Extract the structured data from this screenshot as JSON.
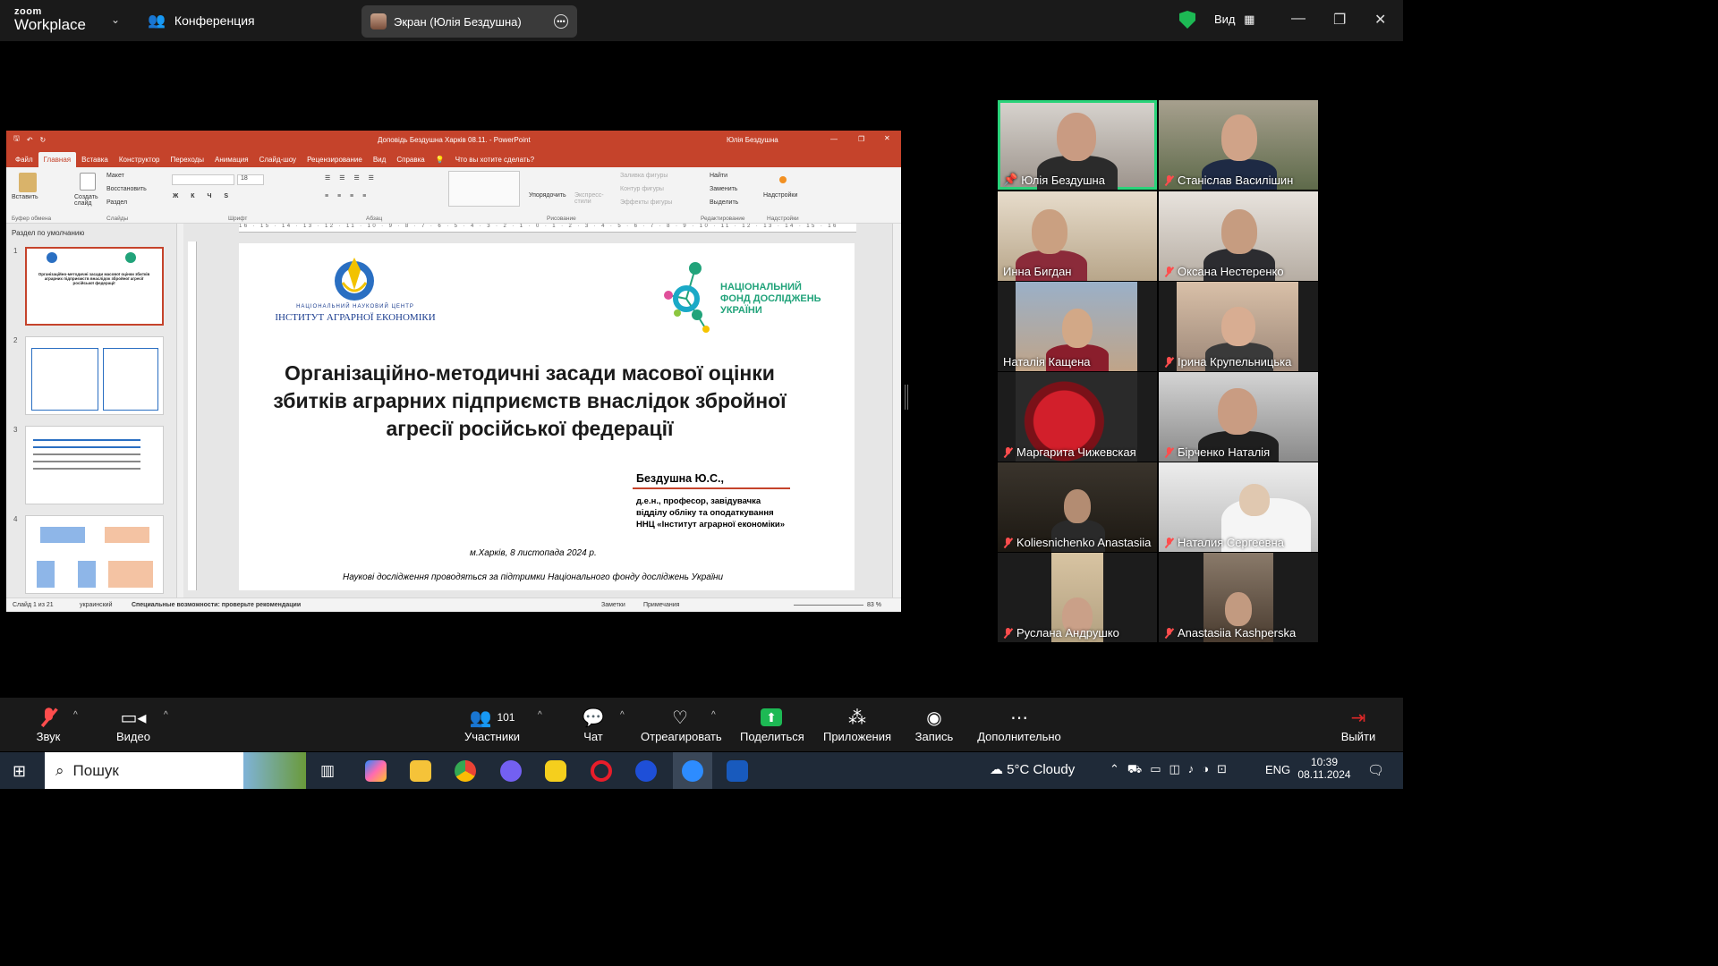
{
  "zoom": {
    "brand_top": "zoom",
    "brand_bottom": "Workplace",
    "conference_label": "Конференция",
    "screen_share_label": "Экран (Юлія Бездушна)",
    "view_label": "Вид"
  },
  "ppt": {
    "window_title": "Доповідь Бездушна Харків 08.11.  -  PowerPoint",
    "user_name": "Юлія Бездушна",
    "tabs": [
      "Файл",
      "Главная",
      "Вставка",
      "Конструктор",
      "Переходы",
      "Анимация",
      "Слайд-шоу",
      "Рецензирование",
      "Вид",
      "Справка"
    ],
    "tell_me": "Что вы хотите сделать?",
    "ribbon": {
      "paste": "Вставить",
      "clipboard": "Буфер обмена",
      "new_slide": "Создать слайд",
      "layout": "Макет",
      "reset": "Восстановить",
      "section": "Раздел",
      "slides_group": "Слайды",
      "font_size": "18",
      "font_group": "Шрифт",
      "paragraph_group": "Абзац",
      "shape_fill": "Заливка фигуры",
      "shape_outline": "Контур фигуры",
      "shape_effects": "Эффекты фигуры",
      "arrange": "Упорядочить",
      "quick_styles": "Экспресс-стили",
      "drawing_group": "Рисование",
      "find": "Найти",
      "replace": "Заменить",
      "select": "Выделить",
      "editing_group": "Редактирование",
      "addins": "Надстройки",
      "addins_group": "Надстройки"
    },
    "section_label": "Раздел по умолчанию",
    "thumb_numbers": [
      "1",
      "2",
      "3",
      "4"
    ],
    "ruler_text": "16 · 15 · 14 · 13 · 12 · 11 · 10 · 9 · 8 · 7 · 6 · 5 · 4 · 3 · 2 · 1 · 0 · 1 · 2 · 3 · 4 · 5 · 6 · 7 · 8 · 9 · 10 · 11 · 12 · 13 · 14 · 15 · 16",
    "slide": {
      "inst_small": "НАЦІОНАЛЬНИЙ НАУКОВИЙ ЦЕНТР",
      "inst_big": "ІНСТИТУТ АГРАРНОЇ ЕКОНОМІКИ",
      "nfd": "НАЦІОНАЛЬНИЙ ФОНД ДОСЛІДЖЕНЬ УКРАЇНИ",
      "title": "Організаційно-методичні засади масової оцінки збитків аграрних підприємств внаслідок збройної агресії російської федерації",
      "author": "Бездушна Ю.С.,",
      "author_line1": "д.е.н., професор, завідувачка",
      "author_line2": "відділу обліку та оподаткування",
      "author_line3": "ННЦ «Інститут аграрної економіки»",
      "place": "м.Харків, 8 листопада 2024 р.",
      "support": "Наукові дослідження проводяться за підтримки Національного фонду досліджень України"
    },
    "status": {
      "slide_of": "Слайд 1 из 21",
      "language": "украинский",
      "accessibility": "Специальные возможности: проверьте рекомендации",
      "notes": "Заметки",
      "comments": "Примечания",
      "zoom_pct": "83 %"
    }
  },
  "participants": [
    {
      "name": "Юлія Бездушна",
      "muted": false,
      "pinned": true
    },
    {
      "name": "Станіслав Василішин",
      "muted": true
    },
    {
      "name": "Инна Бигдан",
      "muted": false
    },
    {
      "name": "Оксана Нестеренко",
      "muted": true
    },
    {
      "name": "Наталія Кащена",
      "muted": false
    },
    {
      "name": "Ірина Крупельницька",
      "muted": true
    },
    {
      "name": "Маргарита Чижевская",
      "muted": true
    },
    {
      "name": "Бірченко Наталія",
      "muted": true
    },
    {
      "name": "Koliesnichenko Anastasiia",
      "muted": true
    },
    {
      "name": "Наталия Сергеевна",
      "muted": true
    },
    {
      "name": "Руслана Андрушко",
      "muted": true
    },
    {
      "name": "Anastasiia Kashperska",
      "muted": true
    }
  ],
  "toolbar": {
    "audio": "Звук",
    "video": "Видео",
    "participants": "Участники",
    "participants_count": "101",
    "chat": "Чат",
    "react": "Отреагировать",
    "share": "Поделиться",
    "apps": "Приложения",
    "record": "Запись",
    "more": "Дополнительно",
    "leave": "Выйти",
    "share_color": "#1db954",
    "leave_color": "#e02828"
  },
  "taskbar": {
    "search_placeholder": "Пошук",
    "weather": "5°C  Cloudy",
    "lang": "ENG",
    "time": "10:39",
    "date": "08.11.2024"
  }
}
